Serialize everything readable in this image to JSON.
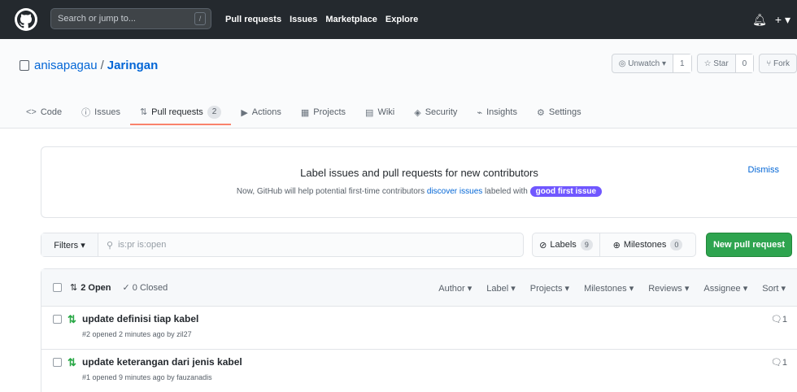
{
  "header": {
    "search_placeholder": "Search or jump to...",
    "search_shortcut": "/",
    "nav": [
      "Pull requests",
      "Issues",
      "Marketplace",
      "Explore"
    ],
    "notifications_icon": "bell-icon",
    "plus_label": "+ ▾"
  },
  "repo": {
    "owner": "anisapagau",
    "separator": "/",
    "name": "Jaringan",
    "watch_label": "◎ Unwatch ▾",
    "watch_count": "1",
    "star_label": "☆ Star",
    "star_count": "0",
    "fork_label": "⑂ Fork"
  },
  "tabs": [
    {
      "icon": "<>",
      "label": "Code"
    },
    {
      "icon": "ⓘ",
      "label": "Issues"
    },
    {
      "icon": "⇅",
      "label": "Pull requests",
      "count": "2"
    },
    {
      "icon": "▶",
      "label": "Actions"
    },
    {
      "icon": "▦",
      "label": "Projects"
    },
    {
      "icon": "▤",
      "label": "Wiki"
    },
    {
      "icon": "◈",
      "label": "Security"
    },
    {
      "icon": "⌁",
      "label": "Insights"
    },
    {
      "icon": "⚙",
      "label": "Settings"
    }
  ],
  "banner": {
    "title": "Label issues and pull requests for new contributors",
    "desc_prefix": "Now, GitHub will help potential first-time contributors",
    "desc_link": "discover issues",
    "desc_middle": "labeled with",
    "label": "good first issue",
    "dismiss": "Dismiss"
  },
  "filter": {
    "filters_label": "Filters ▾",
    "query": "is:pr is:open",
    "labels_label": "Labels",
    "labels_count": "9",
    "milestones_label": "Milestones",
    "milestones_count": "0",
    "new_pr_label": "New pull request"
  },
  "list": {
    "open_label": "2 Open",
    "closed_label": "✓ 0 Closed",
    "sorts": [
      "Author ▾",
      "Label ▾",
      "Projects ▾",
      "Milestones ▾",
      "Reviews ▾",
      "Assignee ▾",
      "Sort ▾"
    ],
    "items": [
      {
        "title": "update definisi tiap kabel",
        "meta": "#2 opened 2 minutes ago by zil27",
        "comments": "1"
      },
      {
        "title": "update keterangan dari jenis kabel",
        "meta": "#1 opened 9 minutes ago by fauzanadis",
        "comments": "1"
      }
    ]
  },
  "colors": {
    "header_bg": "#24292e",
    "accent_blue": "#0366d6",
    "green": "#2ea44f",
    "selected_tab_border": "#f9826c",
    "label_purple": "#7057ff"
  }
}
